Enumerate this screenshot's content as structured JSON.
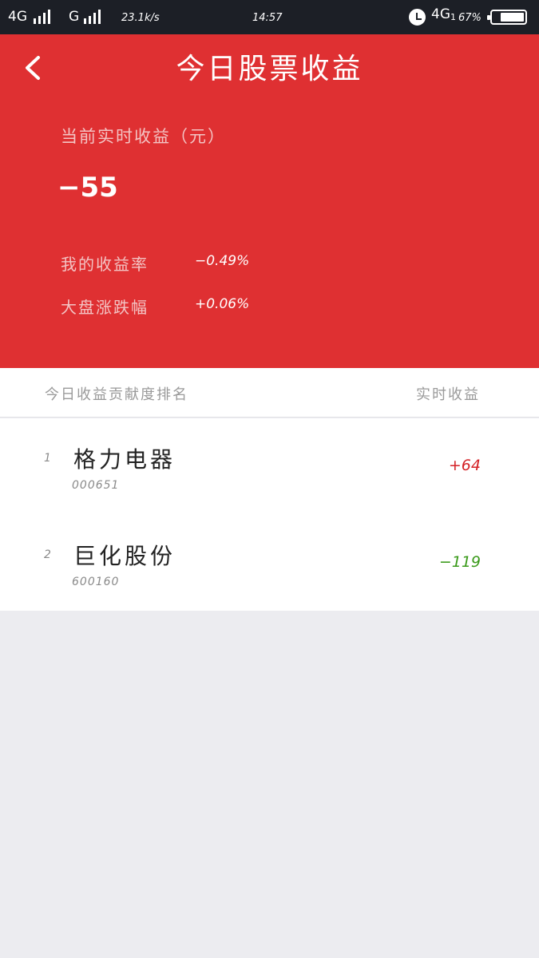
{
  "status_bar": {
    "network1": "4G",
    "network2": "G",
    "speed": "23.1k/s",
    "time": "14:57",
    "network3": "4G",
    "sim_slot": "1",
    "battery_percent": "67%"
  },
  "header": {
    "title": "今日股票收益",
    "earnings_label": "当前实时收益（元）",
    "earnings_value": "−55",
    "my_rate_label": "我的收益率",
    "my_rate_value": "−0.49%",
    "market_label": "大盘涨跌幅",
    "market_value": "+0.06%"
  },
  "list": {
    "header_left": "今日收益贡献度排名",
    "header_right": "实时收益",
    "items": [
      {
        "rank": "1",
        "name": "格力电器",
        "code": "000651",
        "value": "+64",
        "value_color": "#d42226"
      },
      {
        "rank": "2",
        "name": "巨化股份",
        "code": "600160",
        "value": "−119",
        "value_color": "#3a9a1a"
      }
    ]
  },
  "colors": {
    "header_bg": "#df3032",
    "status_bg": "#1c1f26",
    "page_bg": "#ececf0"
  }
}
